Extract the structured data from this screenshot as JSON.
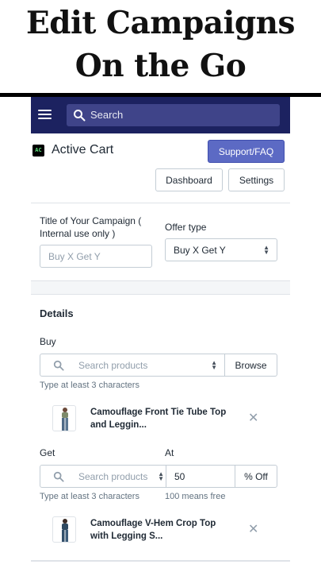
{
  "headline": {
    "line1": "Edit Campaigns",
    "line2": "On the Go"
  },
  "topbar": {
    "menu_icon": "hamburger-icon",
    "search_placeholder": "Search",
    "search_icon": "search-icon"
  },
  "app": {
    "name": "Active Cart",
    "logo_text": "AC",
    "support_label": "Support/FAQ",
    "dashboard_label": "Dashboard",
    "settings_label": "Settings"
  },
  "campaign": {
    "title_label_1": "Title of Your Campaign (",
    "title_label_2": "Internal use only )",
    "title_placeholder": "Buy X Get Y",
    "offer_label": "Offer type",
    "offer_value": "Buy X Get Y"
  },
  "details": {
    "heading": "Details",
    "buy_label": "Buy",
    "buy_placeholder": "Search products",
    "browse_label": "Browse",
    "buy_hint": "Type at least 3 characters",
    "buy_product_1": "Camouflage Front Tie Tube Top",
    "buy_product_2": "and Leggin...",
    "get_label": "Get",
    "at_label": "At",
    "get_placeholder": "Search products",
    "at_value": "50",
    "percent_label": "% Off",
    "get_hint": "Type at least 3 characters",
    "at_hint": "100 means free",
    "get_product_1": "Camouflage V-Hem Crop Top",
    "get_product_2": "with Legging S..."
  },
  "colors": {
    "topbar": "#1c2260",
    "search_bg": "#3f4489",
    "primary": "#5c6ac4"
  }
}
